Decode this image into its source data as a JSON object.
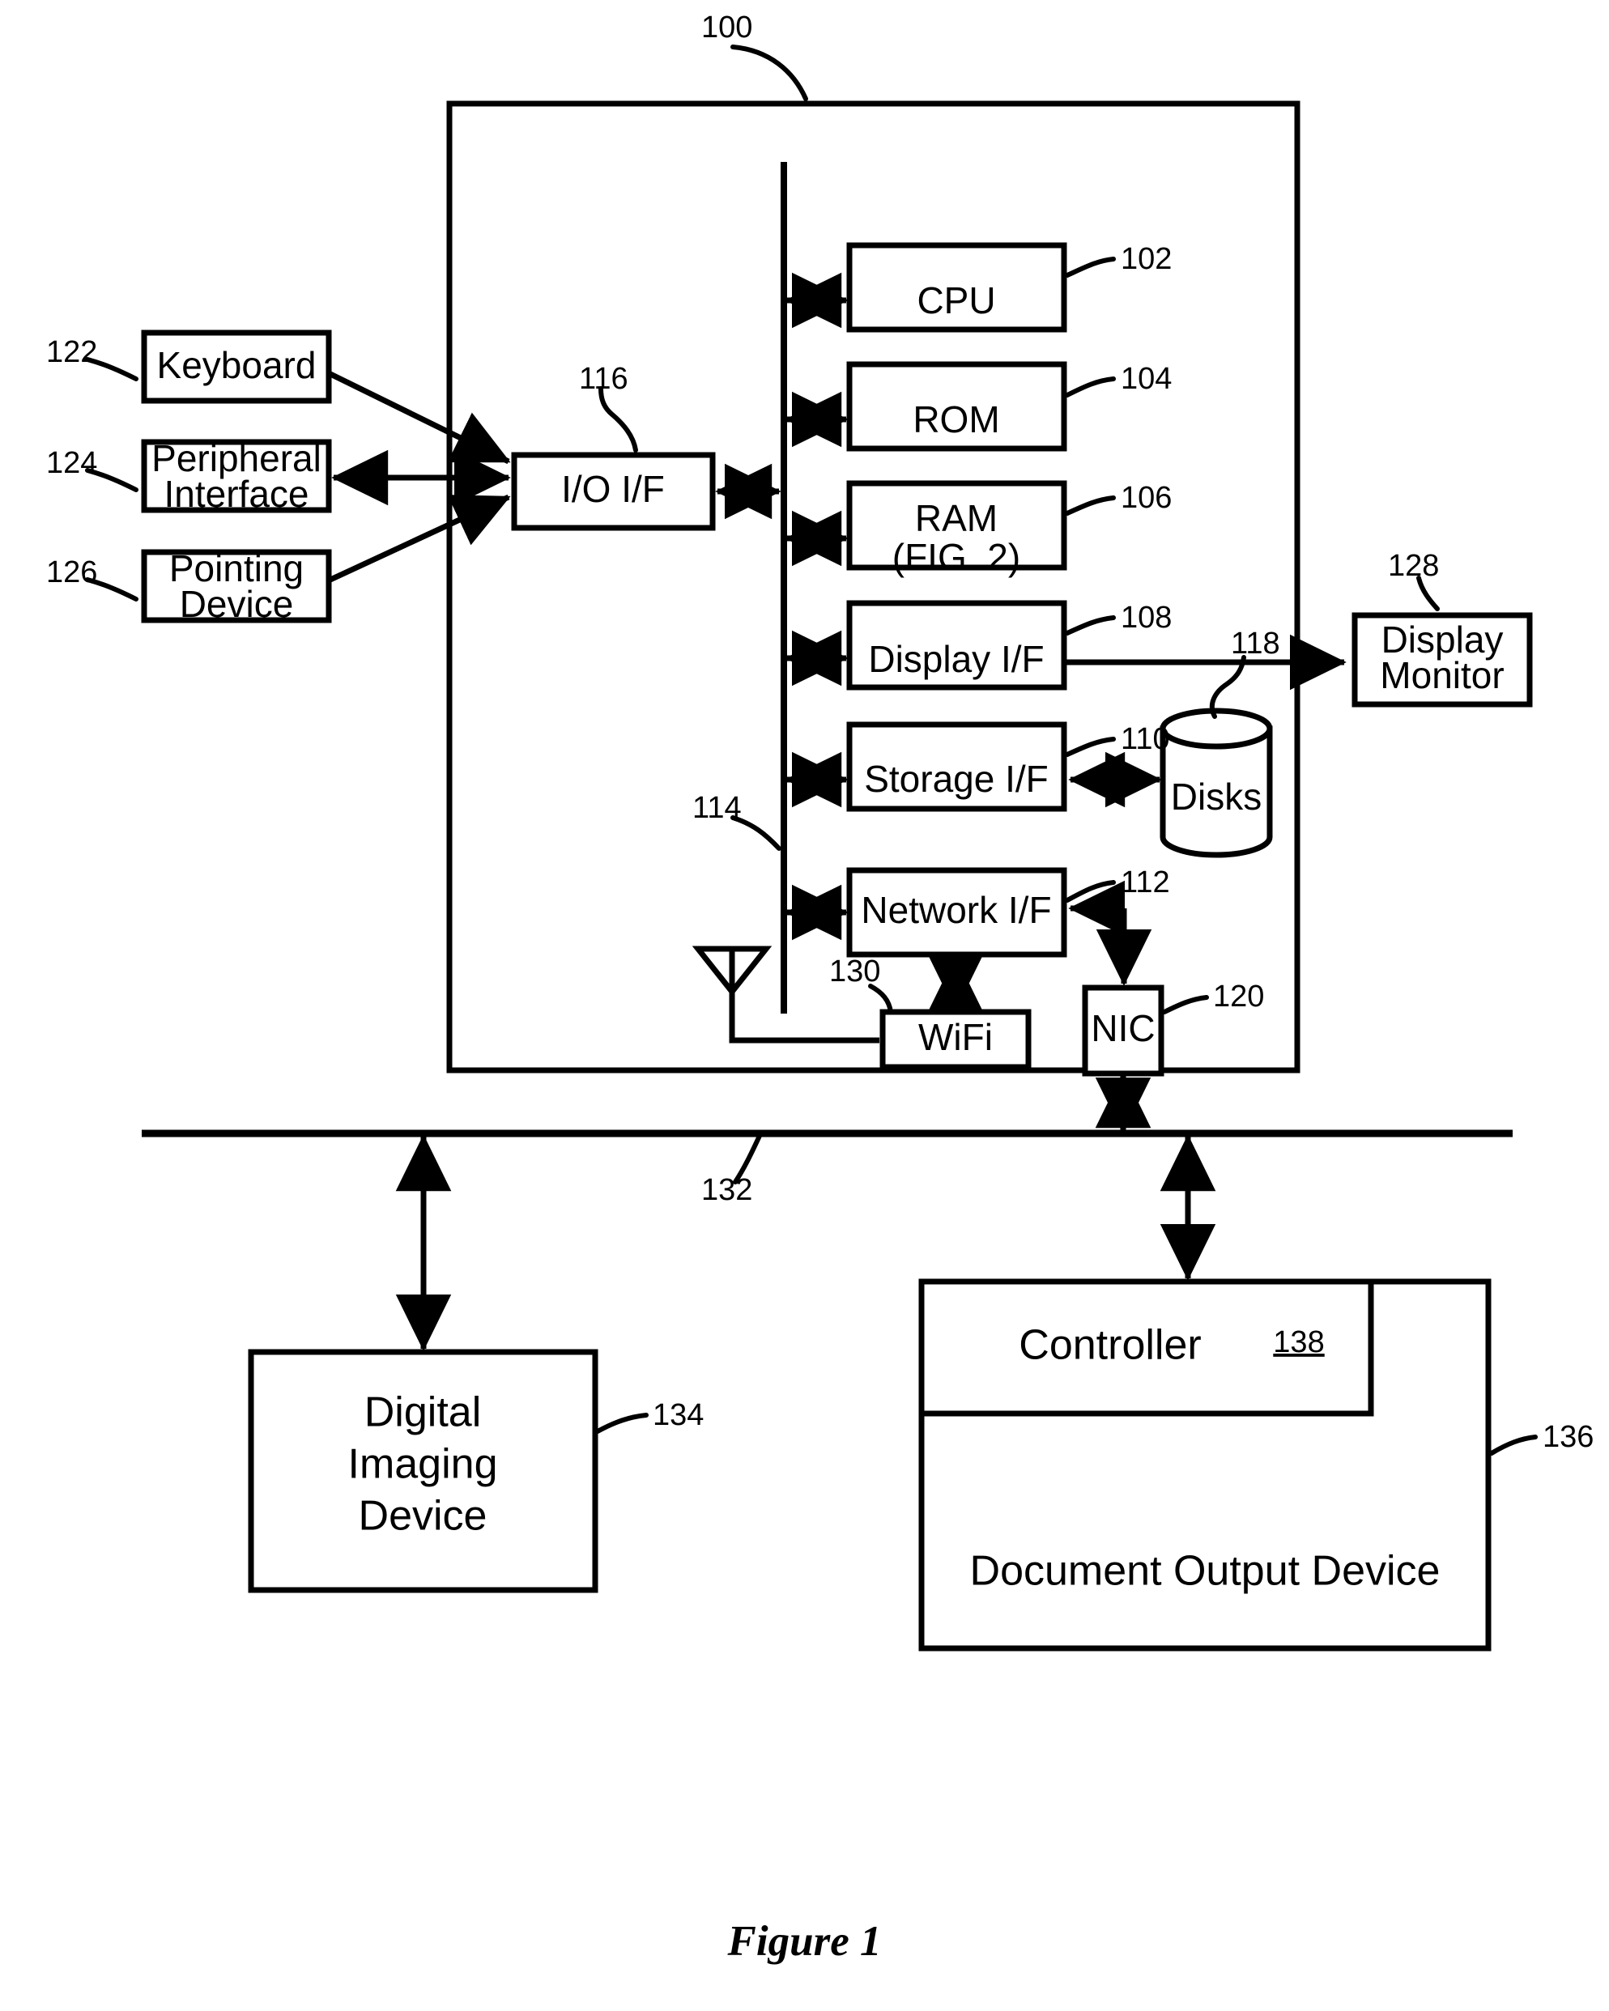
{
  "figure": {
    "caption": "Figure 1",
    "system_ref": "100"
  },
  "blocks": {
    "cpu": {
      "label": "CPU",
      "ref": "102"
    },
    "rom": {
      "label": "ROM",
      "ref": "104"
    },
    "ram": {
      "label": "RAM",
      "label2": "(FIG. 2)",
      "ref": "106"
    },
    "display_if": {
      "label": "Display I/F",
      "ref": "108"
    },
    "storage_if": {
      "label": "Storage I/F",
      "ref": "110"
    },
    "network_if": {
      "label": "Network I/F",
      "ref": "112"
    },
    "bus": {
      "label": "",
      "ref": "114"
    },
    "io_if": {
      "label": "I/O I/F",
      "ref": "116"
    },
    "disks": {
      "label": "Disks",
      "ref": "118"
    },
    "nic": {
      "label": "NIC",
      "ref": "120"
    },
    "keyboard": {
      "label": "Keyboard",
      "ref": "122"
    },
    "peripheral_if": {
      "label": "Peripheral",
      "label2": "Interface",
      "ref": "124"
    },
    "pointing_device": {
      "label": "Pointing",
      "label2": "Device",
      "ref": "126"
    },
    "display_monitor": {
      "label": "Display",
      "label2": "Monitor",
      "ref": "128"
    },
    "wifi": {
      "label": "WiFi",
      "ref": "130"
    },
    "network_line": {
      "label": "",
      "ref": "132"
    },
    "digital_imaging": {
      "label": "Digital",
      "label2": "Imaging",
      "label3": "Device",
      "ref": "134"
    },
    "document_output": {
      "label": "Document Output Device",
      "ref": "136"
    },
    "controller": {
      "label": "Controller",
      "ref": "138"
    }
  },
  "colors": {
    "stroke": "#000000",
    "fill": "#ffffff",
    "background": "#ffffff"
  }
}
